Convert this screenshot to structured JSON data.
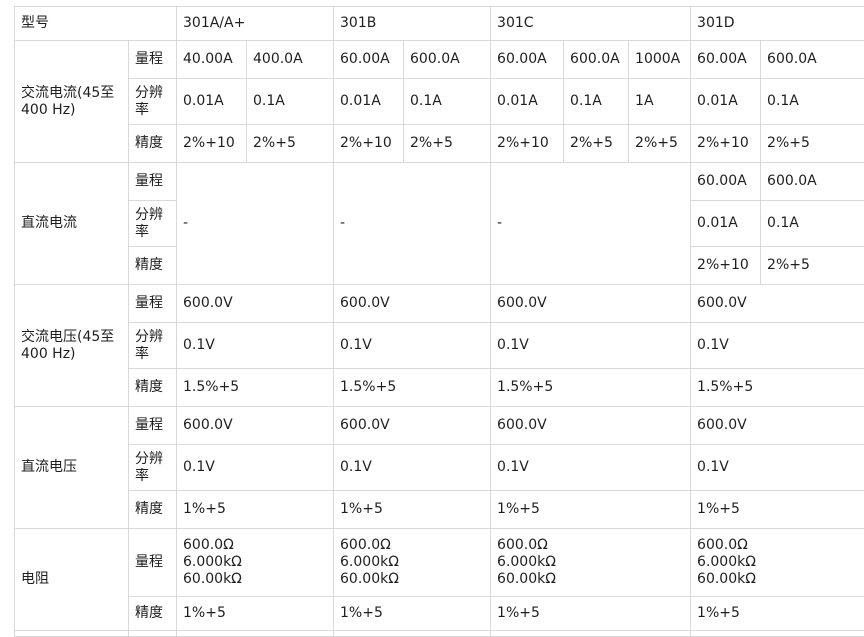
{
  "header": {
    "model_label": "型号",
    "models": [
      "301A/A+",
      "301B",
      "301C",
      "301D"
    ]
  },
  "params": {
    "range": "量程",
    "resolution": "分辨率",
    "accuracy": "精度"
  },
  "ac_current": {
    "label": "交流电流(45至400 Hz)",
    "range": [
      "40.00A",
      "400.0A",
      "60.00A",
      "600.0A",
      "60.00A",
      "600.0A",
      "1000A",
      "60.00A",
      "600.0A"
    ],
    "resolution": [
      "0.01A",
      "0.1A",
      "0.01A",
      "0.1A",
      "0.01A",
      "0.1A",
      "1A",
      "0.01A",
      "0.1A"
    ],
    "accuracy": [
      "2%+10",
      "2%+5",
      "2%+10",
      "2%+5",
      "2%+10",
      "2%+5",
      "2%+5",
      "2%+10",
      "2%+5"
    ]
  },
  "dc_current": {
    "label": "直流电流",
    "na": [
      "-",
      "-",
      "-"
    ],
    "range": [
      "60.00A",
      "600.0A"
    ],
    "resolution": [
      "0.01A",
      "0.1A"
    ],
    "accuracy": [
      "2%+10",
      "2%+5"
    ]
  },
  "ac_voltage": {
    "label": "交流电压(45至400 Hz)",
    "range": [
      "600.0V",
      "600.0V",
      "600.0V",
      "600.0V"
    ],
    "resolution": [
      "0.1V",
      "0.1V",
      "0.1V",
      "0.1V"
    ],
    "accuracy": [
      "1.5%+5",
      "1.5%+5",
      "1.5%+5",
      "1.5%+5"
    ]
  },
  "dc_voltage": {
    "label": "直流电压",
    "range": [
      "600.0V",
      "600.0V",
      "600.0V",
      "600.0V"
    ],
    "resolution": [
      "0.1V",
      "0.1V",
      "0.1V",
      "0.1V"
    ],
    "accuracy": [
      "1%+5",
      "1%+5",
      "1%+5",
      "1%+5"
    ]
  },
  "resistance": {
    "label": "电阻",
    "range_lines": [
      "600.0Ω",
      "6.000kΩ",
      "60.00kΩ"
    ],
    "accuracy": [
      "1%+5",
      "1%+5",
      "1%+5",
      "1%+5"
    ]
  }
}
